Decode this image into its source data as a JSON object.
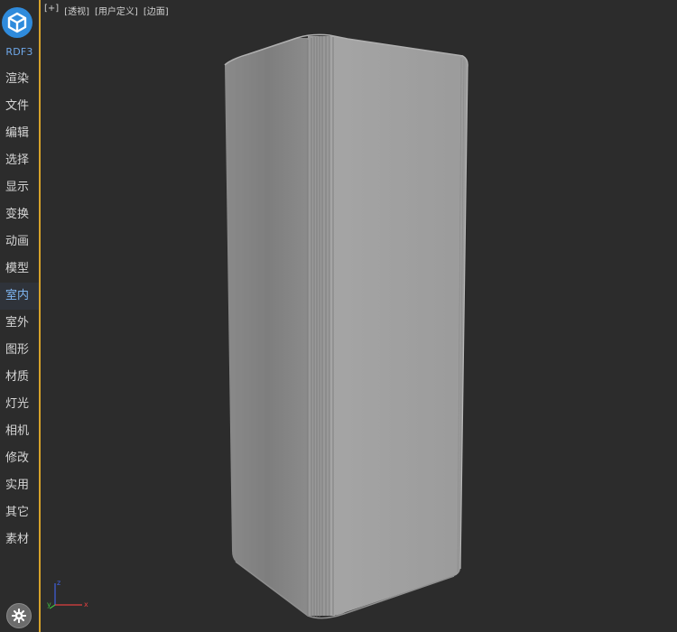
{
  "app": {
    "brand": "RDF3"
  },
  "sidebar": {
    "items": [
      {
        "label": "渲染",
        "active": false
      },
      {
        "label": "文件",
        "active": false
      },
      {
        "label": "编辑",
        "active": false
      },
      {
        "label": "选择",
        "active": false
      },
      {
        "label": "显示",
        "active": false
      },
      {
        "label": "变换",
        "active": false
      },
      {
        "label": "动画",
        "active": false
      },
      {
        "label": "模型",
        "active": false
      },
      {
        "label": "室内",
        "active": true
      },
      {
        "label": "室外",
        "active": false
      },
      {
        "label": "图形",
        "active": false
      },
      {
        "label": "材质",
        "active": false
      },
      {
        "label": "灯光",
        "active": false
      },
      {
        "label": "相机",
        "active": false
      },
      {
        "label": "修改",
        "active": false
      },
      {
        "label": "实用",
        "active": false
      },
      {
        "label": "其它",
        "active": false
      },
      {
        "label": "素材",
        "active": false
      }
    ]
  },
  "viewport": {
    "labels": [
      "[+]",
      "[透视]",
      "[用户定义]",
      "[边面]"
    ]
  },
  "axis": {
    "x": "x",
    "y": "y",
    "z": "z"
  },
  "colors": {
    "accent": "#d7a32a",
    "active_text": "#7fb6f2",
    "logo": "#2f8bdc",
    "x_axis": "#e04040",
    "y_axis": "#3fbf3f",
    "z_axis": "#4060e0"
  },
  "icons": {
    "logo": "cube-logo-icon",
    "settings": "gear-icon"
  }
}
